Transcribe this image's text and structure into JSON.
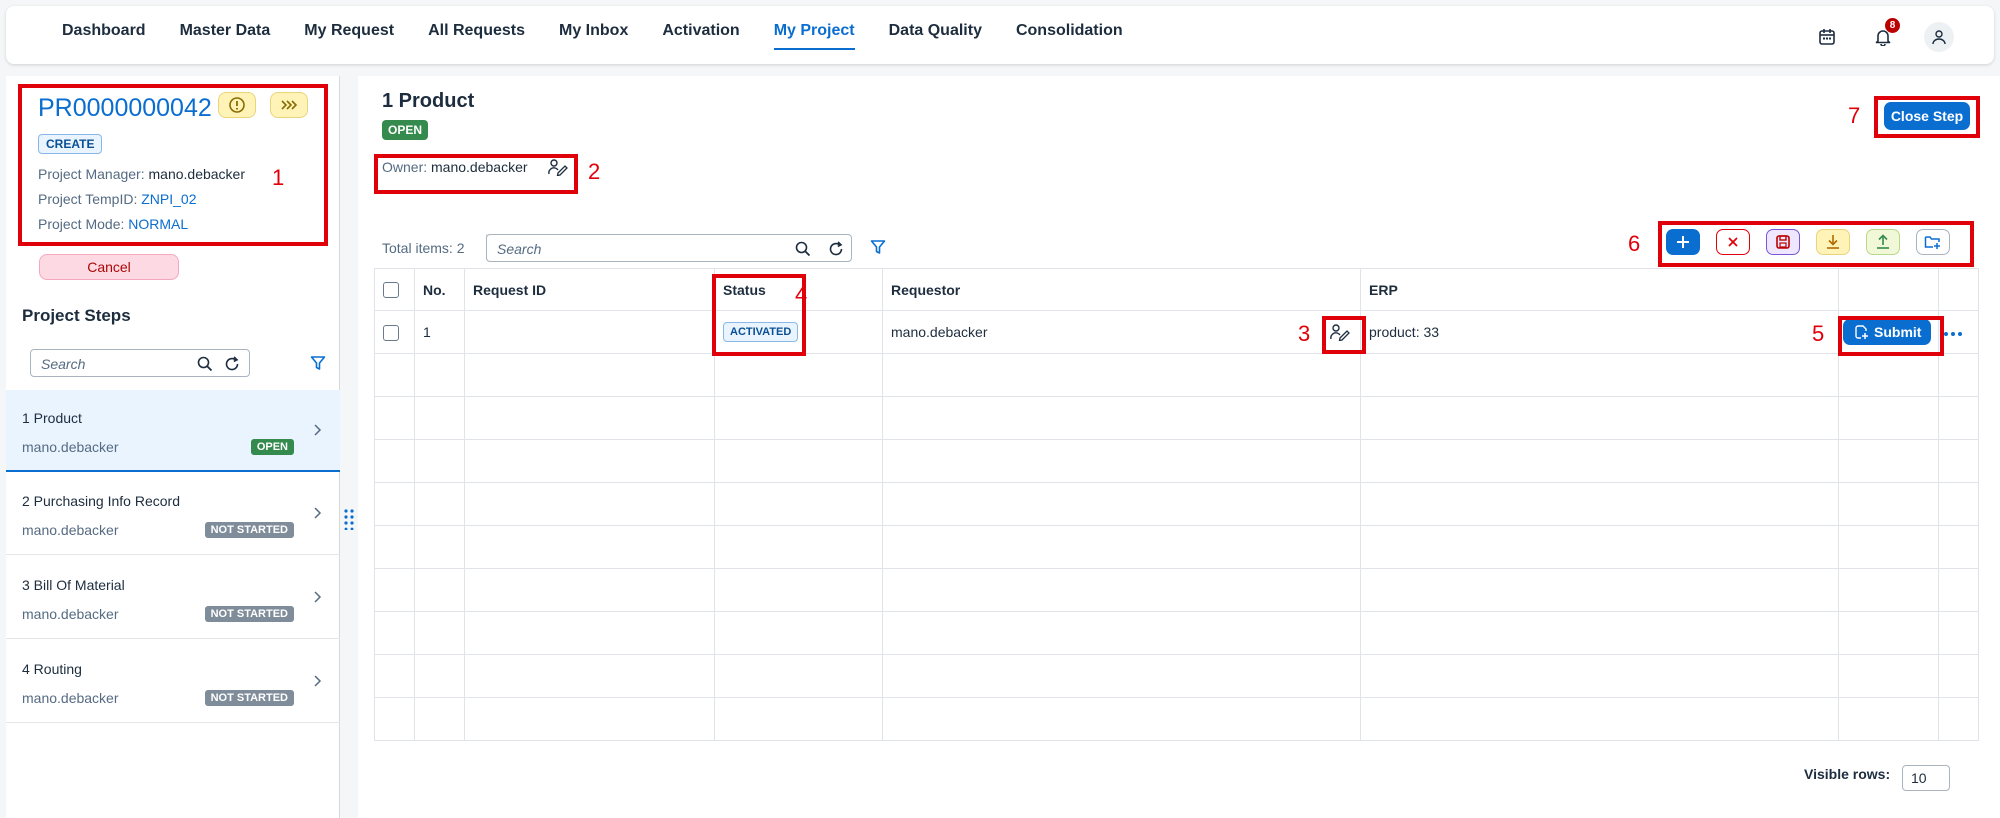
{
  "nav": {
    "items": [
      "Dashboard",
      "Master Data",
      "My Request",
      "All Requests",
      "My Inbox",
      "Activation",
      "My Project",
      "Data Quality",
      "Consolidation"
    ],
    "active": "My Project",
    "notification_count": "8"
  },
  "project": {
    "id": "PR0000000042",
    "type_tag": "CREATE",
    "manager_label": "Project Manager:",
    "manager_value": "mano.debacker",
    "tempid_label": "Project TempID:",
    "tempid_value": "ZNPI_02",
    "mode_label": "Project Mode:",
    "mode_value": "NORMAL",
    "cancel_label": "Cancel"
  },
  "steps": {
    "title": "Project Steps",
    "search_placeholder": "Search",
    "items": [
      {
        "name": "1 Product",
        "owner": "mano.debacker",
        "status": "OPEN"
      },
      {
        "name": "2 Purchasing Info Record",
        "owner": "mano.debacker",
        "status": "NOT STARTED"
      },
      {
        "name": "3 Bill Of Material",
        "owner": "mano.debacker",
        "status": "NOT STARTED"
      },
      {
        "name": "4 Routing",
        "owner": "mano.debacker",
        "status": "NOT STARTED"
      }
    ]
  },
  "detail": {
    "title": "1 Product",
    "status": "OPEN",
    "owner_label": "Owner:",
    "owner_value": "mano.debacker",
    "close_step_label": "Close Step",
    "total_items": "Total items: 2",
    "search_placeholder": "Search"
  },
  "table": {
    "headers": {
      "no": "No.",
      "request_id": "Request ID",
      "status": "Status",
      "requestor": "Requestor",
      "erp": "ERP"
    },
    "rows": [
      {
        "no": "1",
        "request_id": "",
        "status": "ACTIVATED",
        "requestor": "mano.debacker",
        "erp": "product: 33",
        "action": "Submit"
      }
    ],
    "visible_rows_label": "Visible rows:",
    "visible_rows_value": "10"
  },
  "annotations": [
    "1",
    "2",
    "3",
    "4",
    "5",
    "6",
    "7"
  ],
  "colors": {
    "accent": "#0a6ed1",
    "annotation": "#e0000a",
    "positive": "#358a4d"
  }
}
